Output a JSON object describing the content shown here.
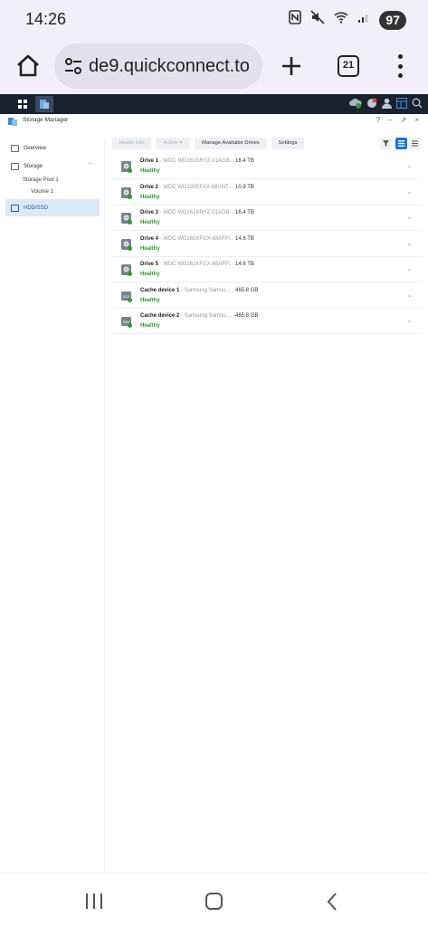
{
  "status_bar": {
    "time": "14:26",
    "battery": "97",
    "icons": [
      "nfc-icon",
      "mute-icon",
      "wifi-icon",
      "signal-icon"
    ]
  },
  "browser": {
    "url": "de9.quickconnect.to",
    "tab_count": "21"
  },
  "window": {
    "title": "Storage Manager",
    "controls": [
      "?",
      "–",
      "⇗",
      "×"
    ]
  },
  "sidebar": {
    "overview": "Overview",
    "storage": "Storage",
    "storage_pool": "Storage Pool 1",
    "volume": "Volume 1",
    "hdd_ssd": "HDD/SSD"
  },
  "toolbar": {
    "health_info": "Health Info",
    "action": "Action ▾",
    "manage_drives": "Manage Available Drives",
    "settings": "Settings"
  },
  "drives": [
    {
      "name": "Drive 1",
      "model": " - WDC WD161KRYZ-01AGB...",
      "size": "16.4 TB",
      "status": "Healthy",
      "type": "hdd"
    },
    {
      "name": "Drive 2",
      "model": " - WDC WD120EFAX-68UNT...",
      "size": "10.9 TB",
      "status": "Healthy",
      "type": "hdd"
    },
    {
      "name": "Drive 3",
      "model": " - WDC WD161KRYZ-01AGB...",
      "size": "16.4 TB",
      "status": "Healthy",
      "type": "hdd"
    },
    {
      "name": "Drive 4",
      "model": " - WDC WD161KFGX-68AFP...",
      "size": "14.6 TB",
      "status": "Healthy",
      "type": "hdd"
    },
    {
      "name": "Drive 5",
      "model": " - WDC WD161KFGX-68AFP...",
      "size": "14.6 TB",
      "status": "Healthy",
      "type": "hdd"
    },
    {
      "name": "Cache device 1",
      "model": " - Samsung Samsu...",
      "size": "465.8 GB",
      "status": "Healthy",
      "type": "ssd"
    },
    {
      "name": "Cache device 2",
      "model": " - Samsung Samsu...",
      "size": "465.8 GB",
      "status": "Healthy",
      "type": "ssd"
    }
  ],
  "colors": {
    "healthy": "#2c9b2c",
    "accent": "#1a73e8",
    "taskbar": "#1a2230"
  }
}
